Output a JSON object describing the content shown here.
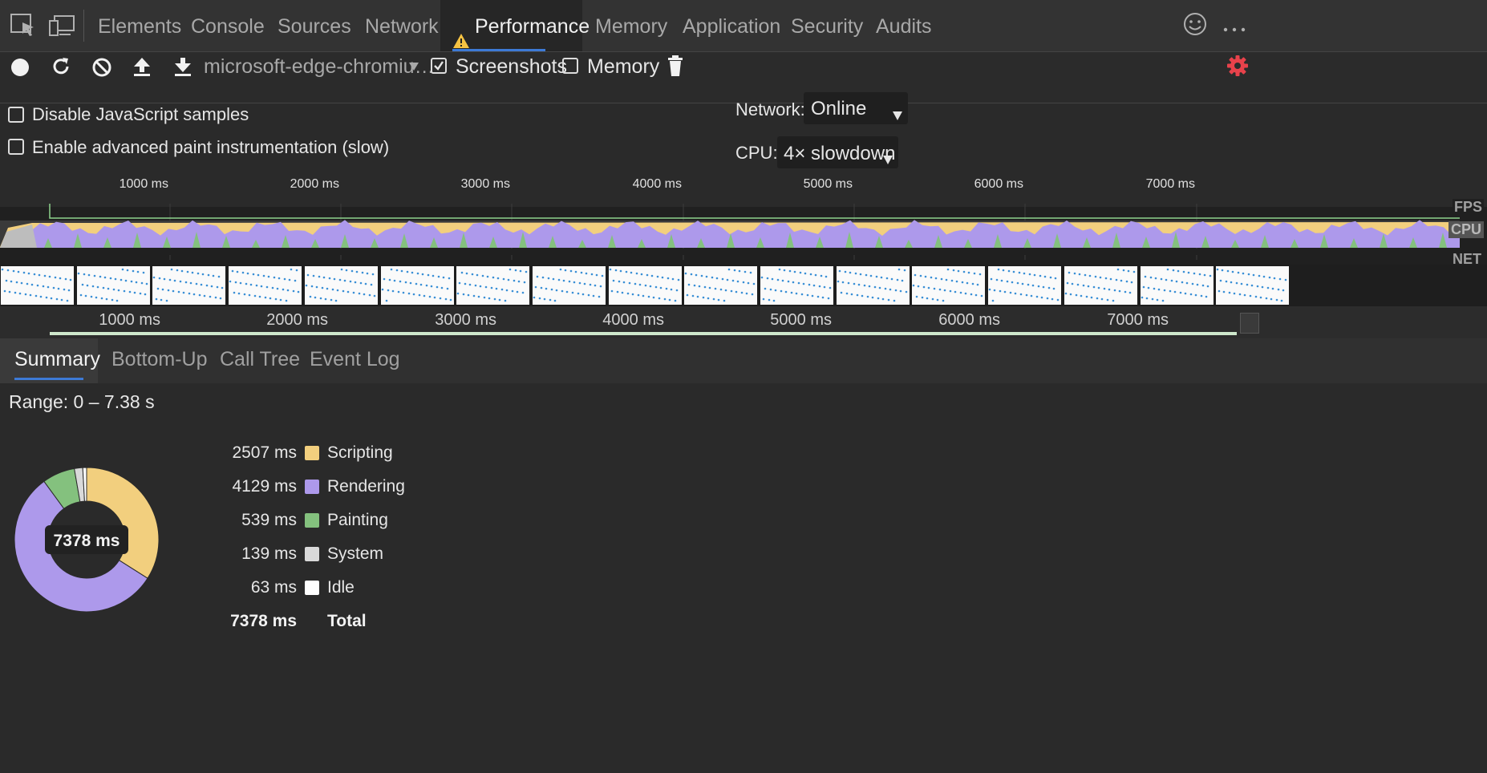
{
  "tabs": [
    "Elements",
    "Console",
    "Sources",
    "Network",
    "Performance",
    "Memory",
    "Application",
    "Security",
    "Audits"
  ],
  "active_tab": "Performance",
  "toolbar": {
    "profile_select": "microsoft-edge-chromiu…",
    "screenshots_label": "Screenshots",
    "screenshots_checked": true,
    "memory_label": "Memory",
    "memory_checked": false
  },
  "settings": {
    "disable_js_samples": "Disable JavaScript samples",
    "advanced_paint": "Enable advanced paint instrumentation (slow)",
    "network_label": "Network:",
    "network_value": "Online",
    "cpu_label": "CPU:",
    "cpu_value": "4× slowdown"
  },
  "overview": {
    "ruler_ticks": [
      "1000 ms",
      "2000 ms",
      "3000 ms",
      "4000 ms",
      "5000 ms",
      "6000 ms",
      "7000 ms"
    ],
    "bottom_ticks": [
      "1000 ms",
      "2000 ms",
      "3000 ms",
      "4000 ms",
      "5000 ms",
      "6000 ms",
      "7000 ms"
    ],
    "track_labels": [
      "FPS",
      "CPU",
      "NET"
    ]
  },
  "detail_tabs": [
    "Summary",
    "Bottom-Up",
    "Call Tree",
    "Event Log"
  ],
  "summary": {
    "range": "Range: 0 – 7.38 s",
    "total_center": "7378 ms",
    "rows": [
      {
        "value": "2507 ms",
        "label": "Scripting",
        "color": "#f2cf7e",
        "ms": 2507
      },
      {
        "value": "4129 ms",
        "label": "Rendering",
        "color": "#ad99eb",
        "ms": 4129
      },
      {
        "value": "539 ms",
        "label": "Painting",
        "color": "#84c17e",
        "ms": 539
      },
      {
        "value": "139 ms",
        "label": "System",
        "color": "#d9d9d9",
        "ms": 139
      },
      {
        "value": "63 ms",
        "label": "Idle",
        "color": "#ffffff",
        "ms": 63
      }
    ],
    "total_value": "7378 ms",
    "total_label": "Total"
  },
  "colors": {
    "accent": "#3d7ad6",
    "warning": "#f5c242",
    "settings_gear": "#e8424b",
    "fps_red": "#e81818"
  }
}
